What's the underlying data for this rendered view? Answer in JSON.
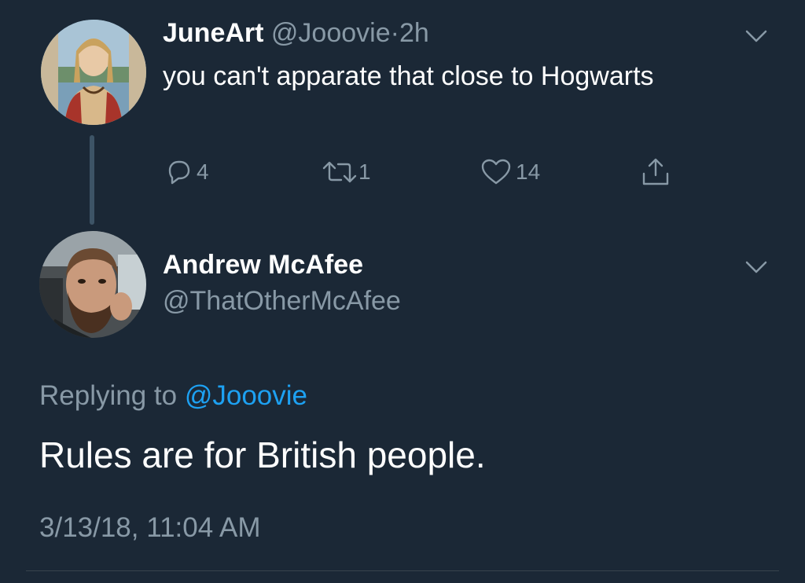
{
  "parent_tweet": {
    "name": "JuneArt",
    "handle": "@Jooovie",
    "separator": "·",
    "time": "2h",
    "text": "you can't apparate that close to Hogwarts",
    "counts": {
      "replies": "4",
      "retweets": "1",
      "likes": "14"
    },
    "avatar_icon": "portrait-painting-avatar"
  },
  "reply_tweet": {
    "name": "Andrew McAfee",
    "handle": "@ThatOtherMcAfee",
    "replying_prefix": "Replying to",
    "replying_handle": "@Jooovie",
    "text": "Rules are for British people.",
    "timestamp": "3/13/18, 11:04 AM",
    "avatar_icon": "bearded-man-avatar"
  },
  "icons": {
    "reply": "reply-icon",
    "retweet": "retweet-icon",
    "like": "heart-icon",
    "share": "share-icon",
    "menu": "chevron-down-icon"
  },
  "colors": {
    "background": "#1b2836",
    "primary_text": "#ffffff",
    "secondary_text": "#8899a6",
    "link": "#1da1f2",
    "thread_line": "#3d5466"
  }
}
